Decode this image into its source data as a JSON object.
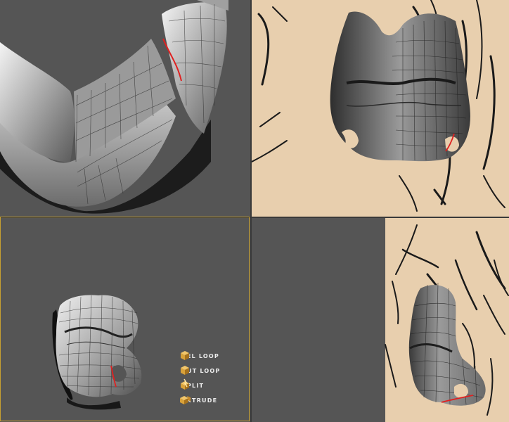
{
  "viewports": [
    {
      "id": "top-left",
      "view": "perspective-bottom",
      "background": "#555555"
    },
    {
      "id": "top-right",
      "view": "front",
      "background": "#e8cfae"
    },
    {
      "id": "bottom-left",
      "view": "perspective",
      "background": "#555555",
      "active": true
    },
    {
      "id": "bottom-right",
      "view": "side",
      "background": "#555555"
    }
  ],
  "colors": {
    "viewport_grey": "#555555",
    "reference_paper": "#e8cfae",
    "active_border": "#c8a030",
    "edge_highlight": "#e02020",
    "tool_icon": "#d9a23a"
  },
  "tools": [
    {
      "label": "SEL LOOP",
      "icon": "box-icon"
    },
    {
      "label": "CUT LOOP",
      "icon": "box-icon"
    },
    {
      "label": "SPLIT",
      "icon": "split-icon"
    },
    {
      "label": "EXTRUDE",
      "icon": "extrude-icon"
    }
  ]
}
